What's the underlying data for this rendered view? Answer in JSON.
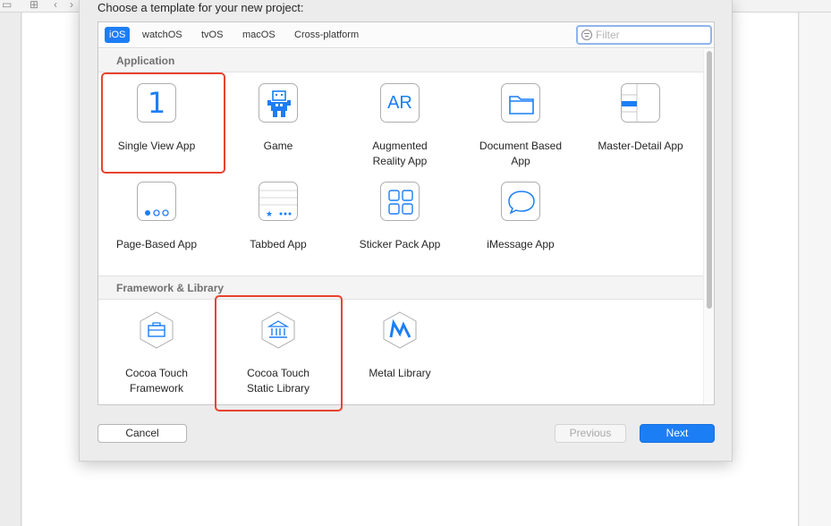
{
  "dialog": {
    "title": "Choose a template for your new project:"
  },
  "platform_tabs": [
    "iOS",
    "watchOS",
    "tvOS",
    "macOS",
    "Cross-platform"
  ],
  "filter": {
    "placeholder": "Filter",
    "value": ""
  },
  "sections": [
    {
      "title": "Application",
      "templates": [
        {
          "label": "Single View App",
          "icon": "single-view-icon",
          "glyph": "1"
        },
        {
          "label": "Game",
          "icon": "game-icon"
        },
        {
          "label": "Augmented\nReality App",
          "icon": "ar-icon",
          "glyph": "AR"
        },
        {
          "label": "Document Based\nApp",
          "icon": "folder-icon"
        },
        {
          "label": "Master-Detail App",
          "icon": "master-detail-icon"
        },
        {
          "label": "Page-Based App",
          "icon": "page-dots-icon"
        },
        {
          "label": "Tabbed App",
          "icon": "tab-bar-icon",
          "glyph": "★ •••"
        },
        {
          "label": "Sticker Pack App",
          "icon": "sticker-grid-icon"
        },
        {
          "label": "iMessage App",
          "icon": "speech-bubble-icon"
        }
      ]
    },
    {
      "title": "Framework & Library",
      "templates": [
        {
          "label": "Cocoa Touch\nFramework",
          "icon": "toolbox-icon"
        },
        {
          "label": "Cocoa Touch\nStatic Library",
          "icon": "library-building-icon"
        },
        {
          "label": "Metal Library",
          "icon": "metal-icon"
        }
      ]
    }
  ],
  "buttons": {
    "cancel": "Cancel",
    "previous": "Previous",
    "next": "Next"
  },
  "colors": {
    "accent": "#1c7ef5",
    "highlight": "#e8432e",
    "icon_blue": "#1c7ef5"
  }
}
